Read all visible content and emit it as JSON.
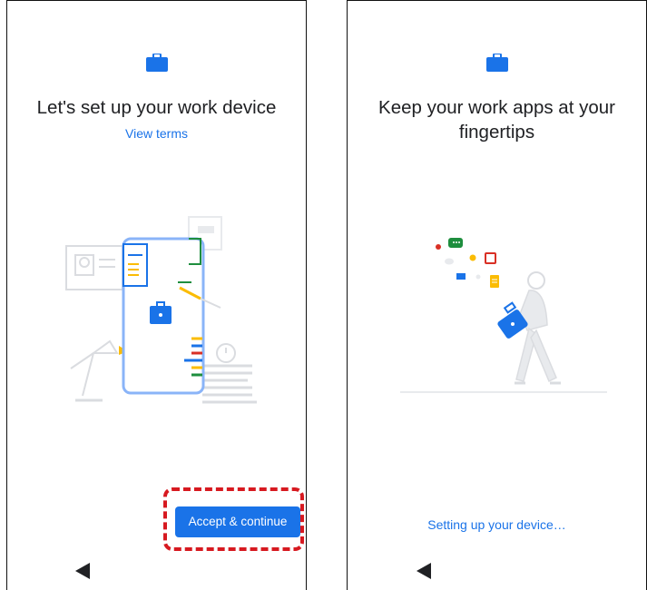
{
  "left_screen": {
    "title": "Let's set up your work device",
    "view_terms": "View terms",
    "accept_button": "Accept & continue"
  },
  "right_screen": {
    "title": "Keep your work apps at your fingertips",
    "status": "Setting up your device…"
  },
  "colors": {
    "accent": "#1a73e8",
    "highlight": "#d71920",
    "text": "#202124"
  },
  "icons": {
    "work": "briefcase-icon",
    "back": "back-triangle-icon"
  }
}
